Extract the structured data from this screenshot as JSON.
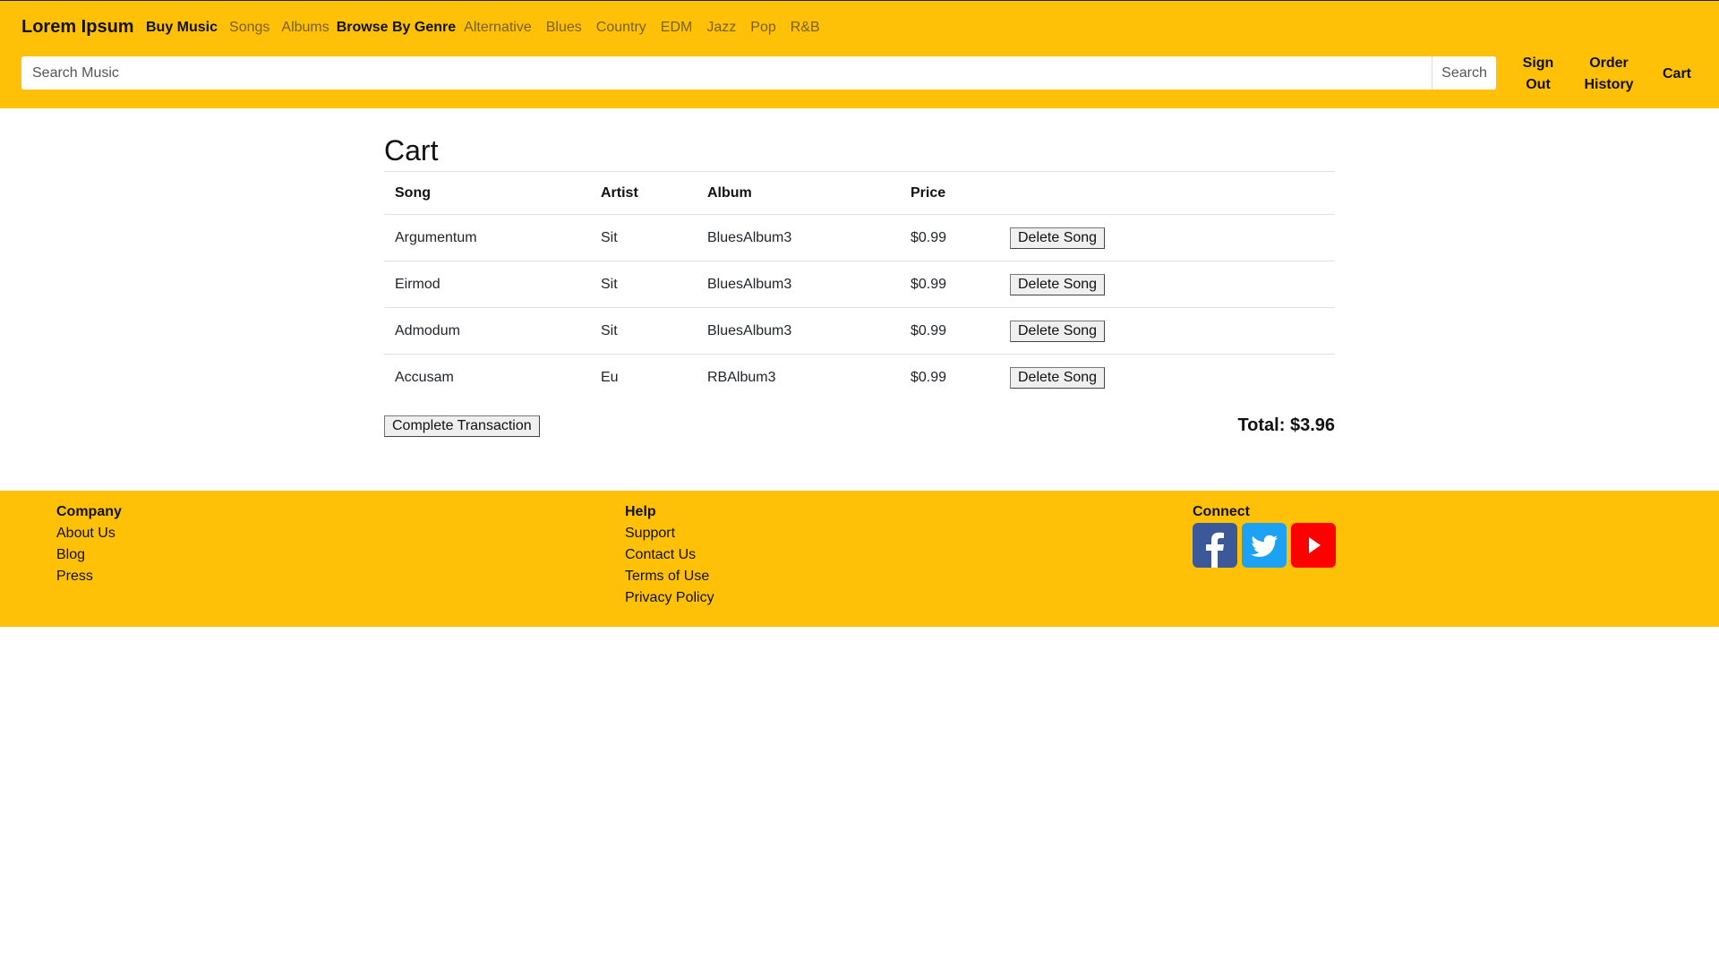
{
  "header": {
    "brand": "Lorem Ipsum",
    "nav": [
      {
        "label": "Buy Music",
        "style": "strong"
      },
      {
        "label": "Songs",
        "style": "muted"
      },
      {
        "label": "Albums",
        "style": "muted"
      },
      {
        "label": "Browse By Genre",
        "style": "strong"
      },
      {
        "label": "Alternative",
        "style": "muted"
      },
      {
        "label": "Blues",
        "style": "muted"
      },
      {
        "label": "Country",
        "style": "muted"
      },
      {
        "label": "EDM",
        "style": "muted"
      },
      {
        "label": "Jazz",
        "style": "muted"
      },
      {
        "label": "Pop",
        "style": "muted"
      },
      {
        "label": "R&B",
        "style": "muted"
      }
    ],
    "search": {
      "placeholder": "Search Music",
      "value": "",
      "button_label": "Search"
    },
    "links": {
      "sign_out_line1": "Sign",
      "sign_out_line2": "Out",
      "order_history_line1": "Order",
      "order_history_line2": "History",
      "cart": "Cart"
    }
  },
  "main": {
    "title": "Cart",
    "columns": [
      "Song",
      "Artist",
      "Album",
      "Price"
    ],
    "rows": [
      {
        "song": "Argumentum",
        "artist": "Sit",
        "album": "BluesAlbum3",
        "price": "$0.99",
        "action": "Delete Song"
      },
      {
        "song": "Eirmod",
        "artist": "Sit",
        "album": "BluesAlbum3",
        "price": "$0.99",
        "action": "Delete Song"
      },
      {
        "song": "Admodum",
        "artist": "Sit",
        "album": "BluesAlbum3",
        "price": "$0.99",
        "action": "Delete Song"
      },
      {
        "song": "Accusam",
        "artist": "Eu",
        "album": "RBAlbum3",
        "price": "$0.99",
        "action": "Delete Song"
      }
    ],
    "complete_label": "Complete Transaction",
    "total": "Total: $3.96"
  },
  "footer": {
    "company": {
      "heading": "Company",
      "links": [
        "About Us",
        "Blog",
        "Press"
      ]
    },
    "help": {
      "heading": "Help",
      "links": [
        "Support",
        "Contact Us",
        "Terms of Use",
        "Privacy Policy"
      ]
    },
    "connect": {
      "heading": "Connect",
      "icons": [
        "facebook-icon",
        "twitter-icon",
        "youtube-icon"
      ]
    }
  },
  "colors": {
    "accent": "#ffc107",
    "facebook": "#3b5998",
    "twitter": "#1da1f2",
    "youtube": "#ff0000"
  }
}
